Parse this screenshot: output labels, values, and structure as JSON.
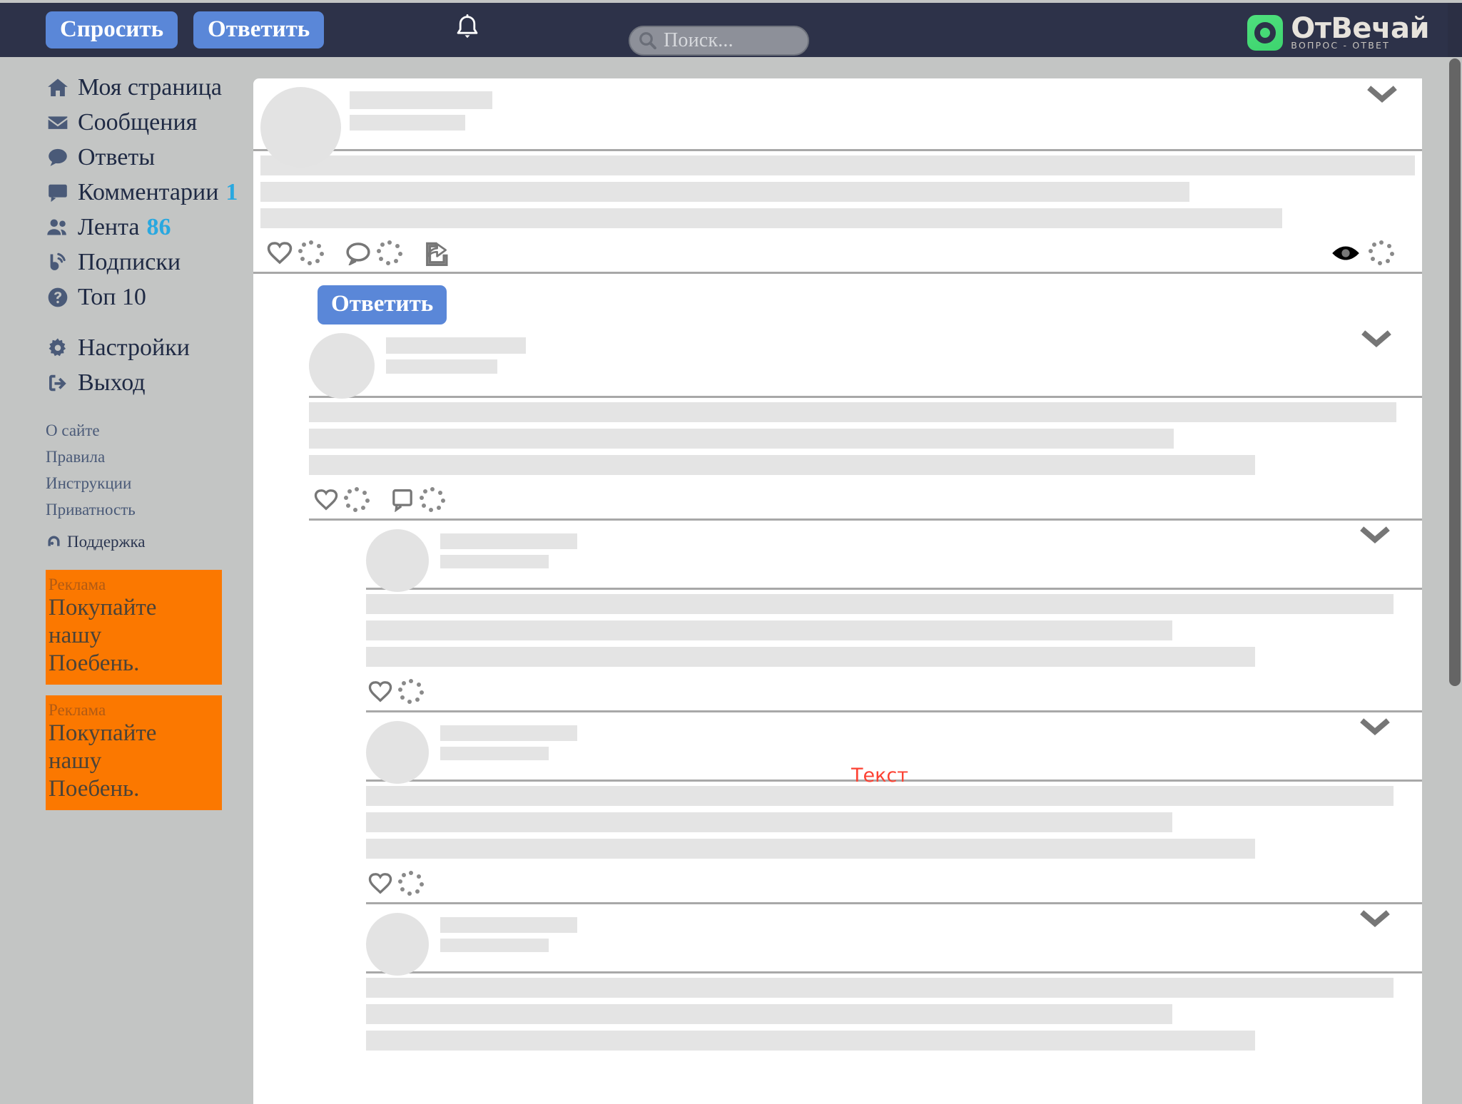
{
  "topbar": {
    "ask_label": "Спросить",
    "answer_label": "Ответить",
    "bell_icon": "bell-icon",
    "search": {
      "placeholder": "Поиск...",
      "value": "",
      "icon": "search-icon"
    },
    "logo": {
      "word": "ОтВечай",
      "subtitle": "ВОПРОС - ОТВЕТ",
      "mark_color": "#43d873"
    },
    "background": "#2d3249",
    "button_color": "#5a87d8"
  },
  "sidebar": {
    "items": [
      {
        "label": "Моя страница",
        "icon": "home-icon",
        "badge": ""
      },
      {
        "label": "Сообщения",
        "icon": "envelope-icon",
        "badge": ""
      },
      {
        "label": "Ответы",
        "icon": "speech-bubble-icon",
        "badge": ""
      },
      {
        "label": "Комментарии",
        "icon": "comment-icon",
        "badge": "1"
      },
      {
        "label": "Лента",
        "icon": "people-icon",
        "badge": "86"
      },
      {
        "label": "Подписки",
        "icon": "rss-icon",
        "badge": ""
      },
      {
        "label": "Топ 10",
        "icon": "question-circle-icon",
        "badge": ""
      }
    ],
    "items2": [
      {
        "label": "Настройки",
        "icon": "gear-icon",
        "badge": ""
      },
      {
        "label": "Выход",
        "icon": "logout-icon",
        "badge": ""
      }
    ],
    "footer_links": [
      "О сайте",
      "Правила",
      "Инструкции",
      "Приватность"
    ],
    "support": {
      "label": "Поддержка",
      "icon": "headset-icon"
    },
    "ads": [
      {
        "label": "Реклама",
        "line1": "Покупайте",
        "line2": "нашу",
        "line3": "Поебень.",
        "color": "#fb7800"
      },
      {
        "label": "Реклама",
        "line1": "Покупайте",
        "line2": "нашу",
        "line3": "Поебень.",
        "color": "#fb7800"
      }
    ],
    "badge_color": "#29a8e0"
  },
  "main": {
    "reply_button_label": "Ответить",
    "text_marker": "Текст",
    "text_marker_color": "#fc4233",
    "post": {
      "collapse_icon": "chevron-down-icon",
      "actions": [
        "heart-icon",
        "loading-spinner",
        "comment-icon",
        "loading-spinner",
        "share-icon"
      ],
      "right_actions": [
        "eye-icon",
        "loading-spinner"
      ]
    },
    "answer": {
      "collapse_icon": "chevron-down-icon",
      "actions": [
        "heart-icon",
        "loading-spinner",
        "comment-icon",
        "loading-spinner"
      ]
    },
    "comments": [
      {
        "collapse_icon": "chevron-down-icon",
        "actions": [
          "heart-icon",
          "loading-spinner"
        ]
      },
      {
        "collapse_icon": "chevron-down-icon",
        "actions": [
          "heart-icon",
          "loading-spinner"
        ]
      },
      {
        "collapse_icon": "chevron-down-icon",
        "actions": []
      }
    ]
  },
  "scrollbar": {
    "thumb_color": "#656565",
    "track_color": "#c3c5c4"
  }
}
